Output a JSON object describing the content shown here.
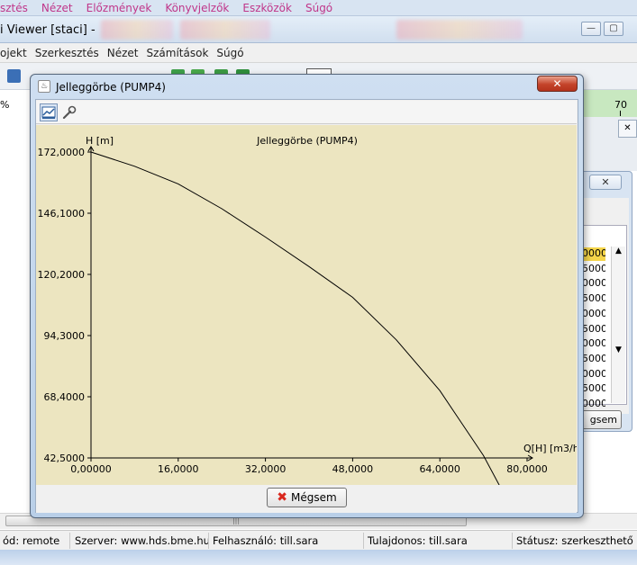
{
  "browser_menu": {
    "items": [
      "sztés",
      "Nézet",
      "Előzmények",
      "Könyvjelzők",
      "Eszközök",
      "Súgó"
    ]
  },
  "app": {
    "title": "i Viewer [staci]  -",
    "menu": [
      "ojekt",
      "Szerkesztés",
      "Nézet",
      "Számítások",
      "Súgó"
    ]
  },
  "background": {
    "percent_label": "%",
    "ruler_label": "70",
    "dialog_close": "✕",
    "right_tab_close": "✕",
    "list_values": [
      "0000",
      "5000",
      "0000",
      "5000",
      "0000",
      "5000",
      "0000",
      "5000",
      "0000",
      "5000",
      "0000",
      "5000"
    ],
    "megsem_partial": "gsem"
  },
  "dialog": {
    "title": "Jelleggörbe (PUMP4)",
    "close_symbol": "✕",
    "cancel_label": "Mégsem",
    "tools": [
      "chart-icon",
      "wrench-icon"
    ]
  },
  "chart_data": {
    "type": "line",
    "title": "Jelleggörbe (PUMP4)",
    "ylabel": "H [m]",
    "xlabel": "Q[H] [m3/h]",
    "xlim": [
      0,
      80
    ],
    "ylim": [
      42.5,
      172.0
    ],
    "x_ticks": [
      "0,00000",
      "16,0000",
      "32,0000",
      "48,0000",
      "64,0000",
      "80,0000"
    ],
    "y_ticks": [
      "172,0000",
      "146,1000",
      "120,2000",
      "94,3000",
      "68,4000",
      "42,5000"
    ],
    "series": [
      {
        "x": [
          0,
          8,
          16,
          24,
          32,
          40,
          48,
          56,
          64,
          72,
          80
        ],
        "y": [
          172.0,
          166.0,
          158.5,
          148.0,
          136.0,
          123.5,
          110.5,
          92.5,
          71.0,
          43.5,
          9.0
        ]
      }
    ],
    "colors": {
      "line": "#000000",
      "background": "#ece5c0"
    }
  },
  "status": {
    "mode": "ód: remote",
    "server": "Szerver: www.hds.bme.hu",
    "user": "Felhasználó: till.sara",
    "owner": "Tulajdonos: till.sara",
    "state": "Státusz: szerkeszthető"
  }
}
